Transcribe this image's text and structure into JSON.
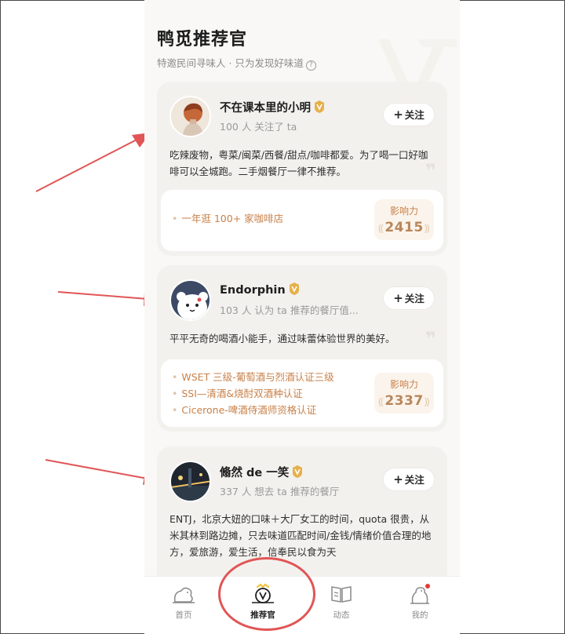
{
  "header": {
    "title": "鸭觅推荐官",
    "subtitle": "特邀民间寻味人 · 只为发现好味道",
    "help_icon_text": "?"
  },
  "cards": [
    {
      "name": "不在课本里的小明",
      "meta": "100 人 关注了 ta",
      "follow_label": "关注",
      "bio": "吃辣废物，粤菜/闽菜/西餐/甜点/咖啡都爱。为了喝一口好咖啡可以全城跑。二手烟餐厅一律不推荐。",
      "tags": [
        "一年逛 100+ 家咖啡店"
      ],
      "influence_label": "影响力",
      "influence_value": "2415"
    },
    {
      "name": "Endorphin",
      "meta": "103 人 认为 ta 推荐的餐厅值...",
      "follow_label": "关注",
      "bio": "平平无奇的喝酒小能手，通过味蕾体验世界的美好。",
      "tags": [
        "WSET 三级-葡萄酒与烈酒认证三级",
        "SSI—清酒&烧酎双酒种认证",
        "Cicerone-啤酒侍酒师资格认证"
      ],
      "influence_label": "影响力",
      "influence_value": "2337"
    },
    {
      "name": "翛然 de 一笑",
      "meta": "337 人 想去 ta 推荐的餐厅",
      "follow_label": "关注",
      "bio": "ENTJ，北京大妞的口味＋大厂女工的时间，quota 很贵，从米其林到路边摊，只去味道匹配时间/金钱/情绪价值合理的地方，爱旅游，爱生活，信奉民以食为天"
    }
  ],
  "tabbar": {
    "items": [
      {
        "label": "首页",
        "icon": "home-duck-icon",
        "active": false
      },
      {
        "label": "推荐官",
        "icon": "recommender-v-icon",
        "active": true
      },
      {
        "label": "动态",
        "icon": "feed-book-icon",
        "active": false
      },
      {
        "label": "我的",
        "icon": "profile-duck-icon",
        "active": false
      }
    ]
  },
  "colors": {
    "accent_text": "#c8814a",
    "influence_bg": "#fbf4ec",
    "annotation_red": "#e15556",
    "badge_gold": "#e6b04a",
    "notification_dot": "#e53935"
  }
}
